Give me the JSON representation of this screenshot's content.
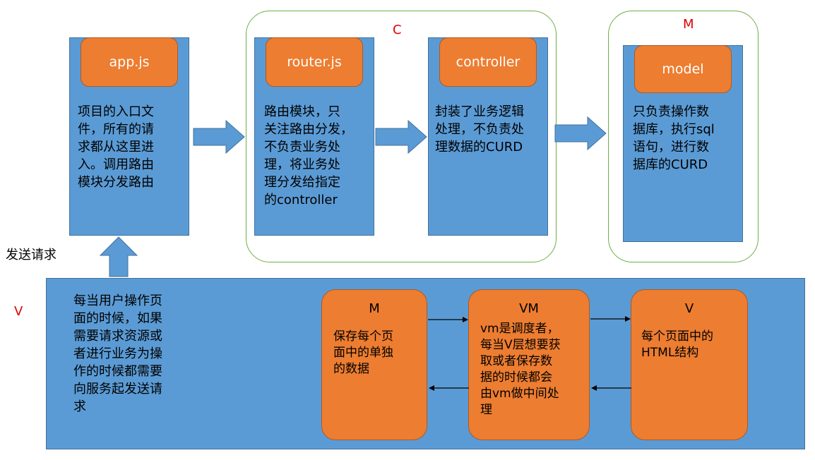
{
  "top": {
    "app": {
      "title": "app.js",
      "desc": "项目的入口文\n件，所有的请\n求都从这里进\n入。调用路由\n模块分发路由"
    },
    "controller_group": {
      "label": "C",
      "router": {
        "title": "router.js",
        "desc": "路由模块，只\n关注路由分发，\n不负责业务处\n理，将业务处\n理分发给指定\n的controller"
      },
      "controller": {
        "title": "controller",
        "desc": "封装了业务逻辑\n处理，不负责处\n理数据的CURD"
      }
    },
    "model_group": {
      "label": "M",
      "model": {
        "title": "model",
        "desc": "只负责操作数\n据库，执行sql\n语句，进行数\n据库的CURD"
      }
    }
  },
  "send_request_label": "发送请求",
  "view": {
    "label": "V",
    "desc": "每当用户操作页\n面的时候，如果\n需要请求资源或\n者进行业务为操\n作的时候都需要\n向服务起发送请\n求",
    "m_box": {
      "title": "M",
      "desc": "保存每个页\n面中的单独\n的数据"
    },
    "vm_box": {
      "title": "VM",
      "desc": "vm是调度者，\n每当V层想要获\n取或者保存数\n据的时候都会\n由vm做中间处\n理"
    },
    "v_box": {
      "title": "V",
      "desc": "每个页面中的\nHTML结构"
    }
  },
  "colors": {
    "blue": "#5b9bd5",
    "orange": "#ed7d31",
    "green_border": "#70ad47",
    "label_red": "#e00000"
  }
}
